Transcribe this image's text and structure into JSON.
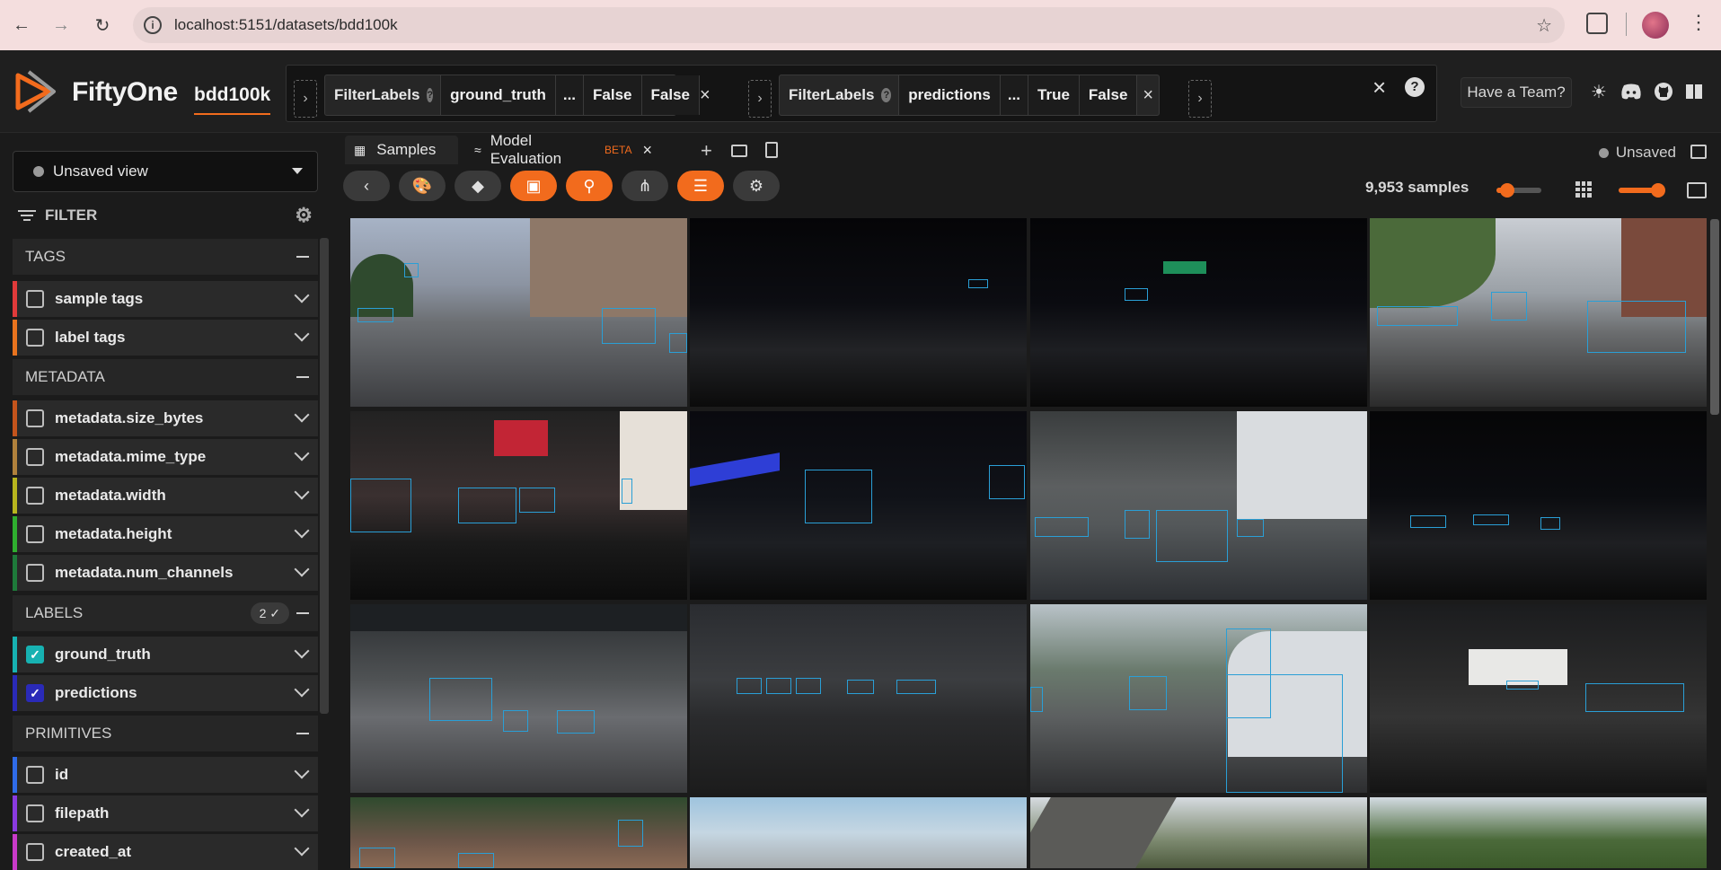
{
  "browser": {
    "url": "localhost:5151/datasets/bdd100k",
    "icons": [
      "back-icon",
      "forward-icon",
      "reload-icon",
      "info-icon",
      "star-icon",
      "extensions-icon",
      "profile-avatar",
      "more-icon"
    ]
  },
  "header": {
    "brand": "FiftyOne",
    "dataset": "bdd100k",
    "stages": [
      {
        "name": "FilterLabels",
        "params": [
          "ground_truth",
          "...",
          "False",
          "False"
        ]
      },
      {
        "name": "FilterLabels",
        "params": [
          "predictions",
          "...",
          "True",
          "False"
        ]
      }
    ],
    "help_glyph": "?",
    "team_button": "Have a Team?",
    "icons": [
      "sun-icon",
      "discord-icon",
      "github-icon",
      "book-icon"
    ]
  },
  "sidebar": {
    "view_selector": "Unsaved view",
    "filter_label": "FILTER",
    "groups": [
      {
        "name": "TAGS",
        "fields": [
          {
            "label": "sample tags",
            "color": "#e03a3a",
            "checked": false
          },
          {
            "label": "label tags",
            "color": "#e8731e",
            "checked": false
          }
        ]
      },
      {
        "name": "METADATA",
        "fields": [
          {
            "label": "metadata.size_bytes",
            "color": "#c4541c",
            "checked": false
          },
          {
            "label": "metadata.mime_type",
            "color": "#b0813c",
            "checked": false
          },
          {
            "label": "metadata.width",
            "color": "#b8b51e",
            "checked": false
          },
          {
            "label": "metadata.height",
            "color": "#2fae2f",
            "checked": false
          },
          {
            "label": "metadata.num_channels",
            "color": "#1e7a3a",
            "checked": false
          }
        ]
      },
      {
        "name": "LABELS",
        "badge": "2 ✓",
        "fields": [
          {
            "label": "ground_truth",
            "color": "#17b2b2",
            "checked": true
          },
          {
            "label": "predictions",
            "color": "#2a2ab8",
            "checked": true
          }
        ]
      },
      {
        "name": "PRIMITIVES",
        "fields": [
          {
            "label": "id",
            "color": "#2f6be8",
            "checked": false
          },
          {
            "label": "filepath",
            "color": "#8a3ae0",
            "checked": false
          },
          {
            "label": "created_at",
            "color": "#c93ac9",
            "checked": false
          }
        ]
      }
    ]
  },
  "main": {
    "tabs": [
      {
        "label": "Samples",
        "icon": "grid-icon"
      },
      {
        "label": "Model Evaluation",
        "badge": "BETA",
        "icon": "evaluation-icon"
      }
    ],
    "status": "Unsaved",
    "sample_count": "9,953 samples",
    "toolbar_icons": [
      "collapse-icon",
      "palette-icon",
      "tag-icon",
      "selection-icon",
      "search-icon",
      "merge-icon",
      "list-icon",
      "settings-icon"
    ],
    "accent": "#f26b1d",
    "box_color": "#2a9fd6"
  }
}
